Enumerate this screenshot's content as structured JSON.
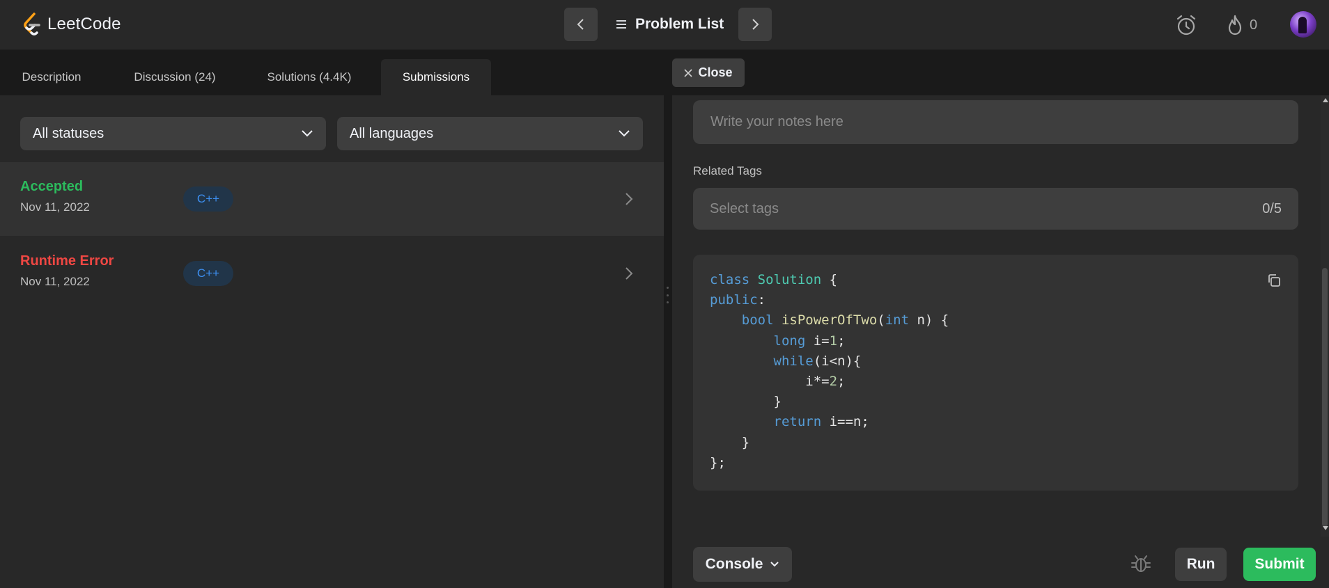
{
  "header": {
    "brand": "LeetCode",
    "problem_list_label": "Problem List",
    "streak_count": "0"
  },
  "tabs": [
    {
      "label": "Description"
    },
    {
      "label": "Discussion (24)"
    },
    {
      "label": "Solutions (4.4K)"
    },
    {
      "label": "Submissions"
    }
  ],
  "filters": {
    "status": "All statuses",
    "language": "All languages"
  },
  "submissions": [
    {
      "status": "Accepted",
      "date": "Nov 11, 2022",
      "language": "C++",
      "status_color": "#2cbb5d"
    },
    {
      "status": "Runtime Error",
      "date": "Nov 11, 2022",
      "language": "C++",
      "status_color": "#ef4743"
    }
  ],
  "detail": {
    "close_label": "Close",
    "notes_placeholder": "Write your notes here",
    "related_tags_label": "Related Tags",
    "tags_placeholder": "Select tags",
    "tags_count": "0/5",
    "code_lines": [
      "class Solution {",
      "public:",
      "    bool isPowerOfTwo(int n) {",
      "        long i=1;",
      "        while(i<n){",
      "            i*=2;",
      "        }",
      "        return i==n;",
      "    }",
      "};"
    ]
  },
  "footer": {
    "console_label": "Console",
    "run_label": "Run",
    "submit_label": "Submit"
  },
  "colors": {
    "accent_green": "#2cbb5d",
    "error_red": "#ef4743",
    "brand_orange": "#ffa116"
  }
}
